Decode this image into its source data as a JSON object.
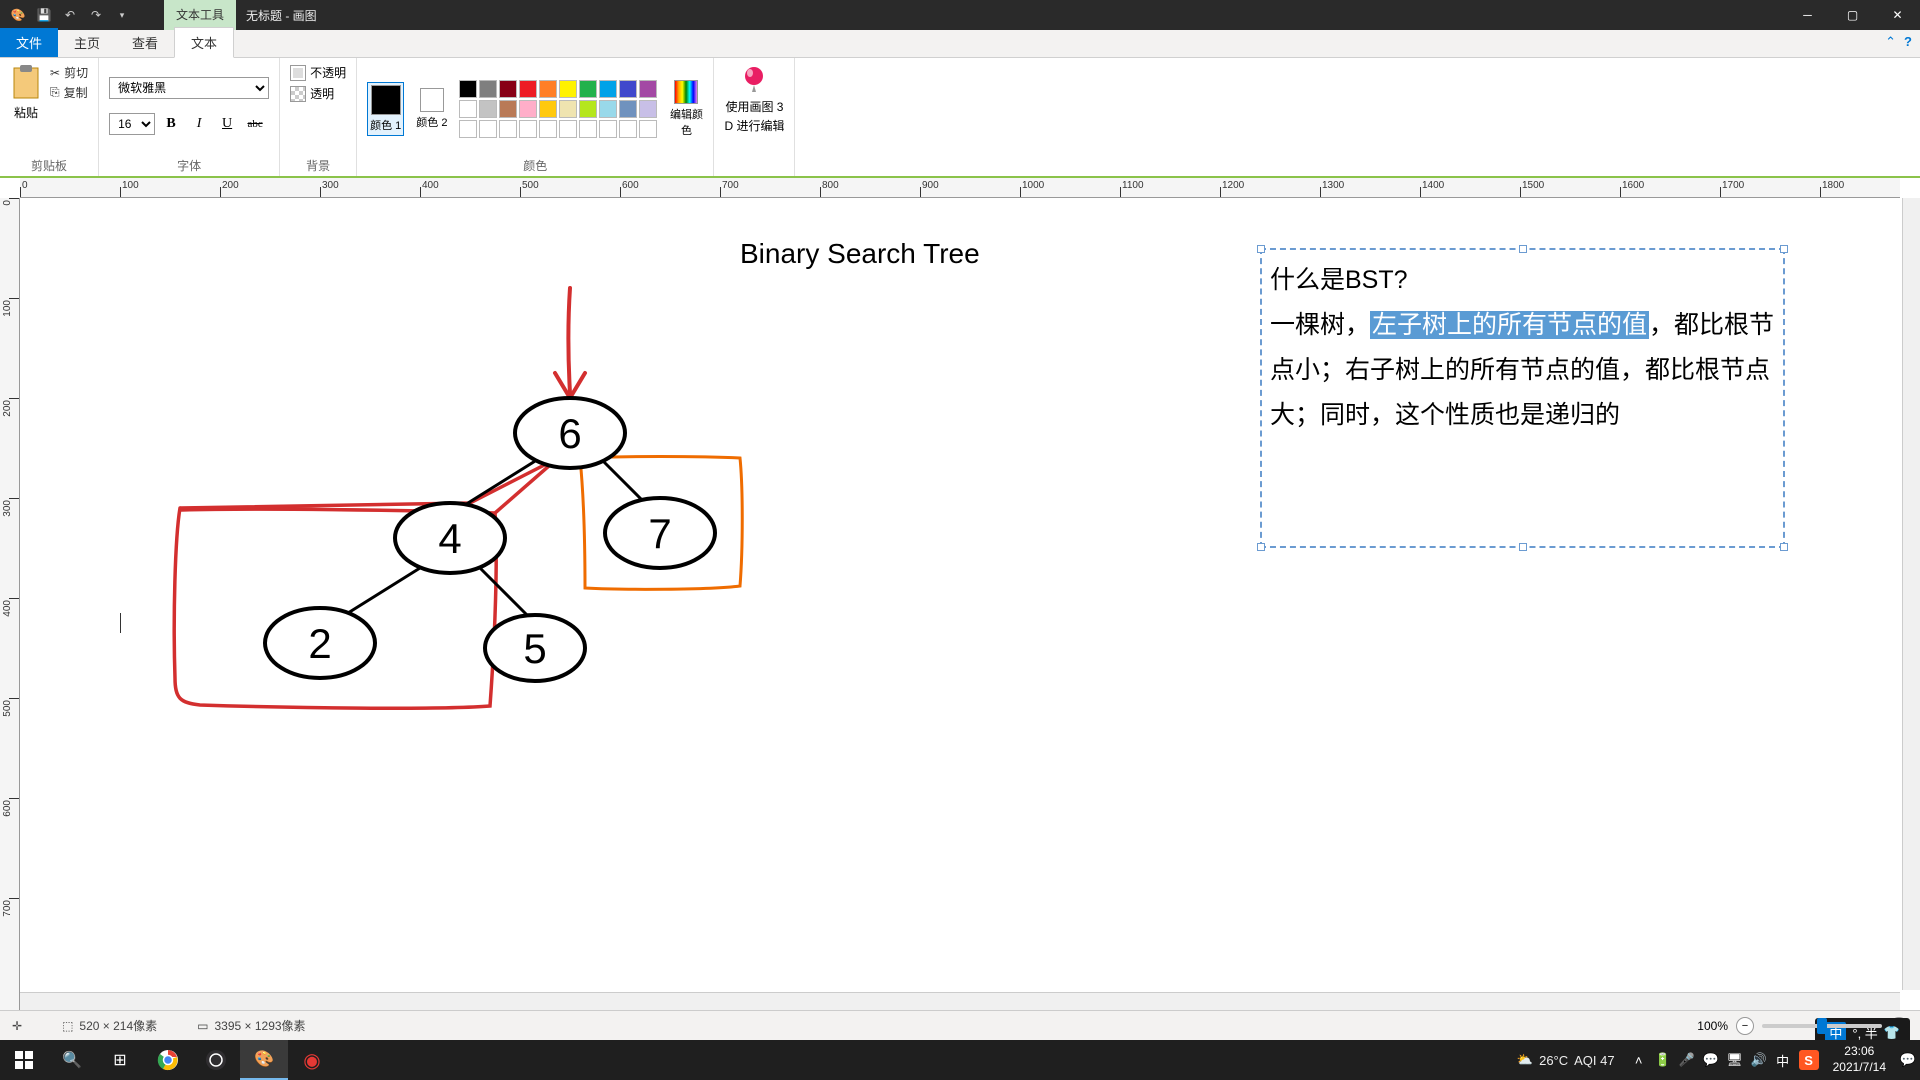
{
  "window": {
    "tool_context": "文本工具",
    "title": "无标题 - 画图"
  },
  "tabs": {
    "file": "文件",
    "home": "主页",
    "view": "查看",
    "text": "文本"
  },
  "ribbon": {
    "clipboard": {
      "paste": "粘贴",
      "cut": "剪切",
      "copy": "复制",
      "group_label": "剪贴板"
    },
    "font": {
      "family": "微软雅黑",
      "size": "16",
      "group_label": "字体"
    },
    "background": {
      "opaque": "不透明",
      "transparent": "透明",
      "group_label": "背景"
    },
    "colors": {
      "color1_label": "颜色 1",
      "color2_label": "颜色 2",
      "edit_label": "编辑颜色",
      "group_label": "颜色",
      "color1": "#000000",
      "color2": "#ffffff",
      "palette_row1": [
        "#000000",
        "#7f7f7f",
        "#880015",
        "#ed1c24",
        "#ff7f27",
        "#fff200",
        "#22b14c",
        "#00a2e8",
        "#3f48cc",
        "#a349a4"
      ],
      "palette_row2": [
        "#ffffff",
        "#c3c3c3",
        "#b97a57",
        "#ffaec9",
        "#ffc90e",
        "#efe4b0",
        "#b5e61d",
        "#99d9ea",
        "#7092be",
        "#c8bfe7"
      ],
      "palette_row3": [
        "#ffffff",
        "#ffffff",
        "#ffffff",
        "#ffffff",
        "#ffffff",
        "#ffffff",
        "#ffffff",
        "#ffffff",
        "#ffffff",
        "#ffffff"
      ]
    },
    "paint3d": {
      "label_line1": "使用画图 3",
      "label_line2": "D 进行编辑"
    }
  },
  "ruler": {
    "h_marks": [
      0,
      100,
      200,
      300,
      400,
      500,
      600,
      700,
      800,
      900,
      1000,
      1100,
      1200,
      1300,
      1400,
      1500,
      1600,
      1700,
      1800
    ],
    "v_marks": [
      0,
      100,
      200,
      300,
      400,
      500,
      600,
      700
    ]
  },
  "canvas": {
    "title_text": "Binary Search Tree",
    "textbox": {
      "line1": "什么是BST?",
      "line2_pre": "一棵树，",
      "line2_highlight": "左子树上的所有节点的值",
      "line2_post": "，都比根节点小；右子树上的所有节点的值，都比根节点大；同时，这个性质也是递归的"
    },
    "tree_nodes": [
      "6",
      "4",
      "7",
      "2",
      "5"
    ]
  },
  "ime": {
    "text": "中 °, 半 👕"
  },
  "status_bar": {
    "selection_size": "520 × 214像素",
    "canvas_size": "3395 × 1293像素",
    "zoom_label": "100%"
  },
  "taskbar": {
    "weather_temp": "26°C",
    "weather_aqi": "AQI 47",
    "ime_lang": "中",
    "clock_time": "23:06",
    "clock_date": "2021/7/14"
  }
}
